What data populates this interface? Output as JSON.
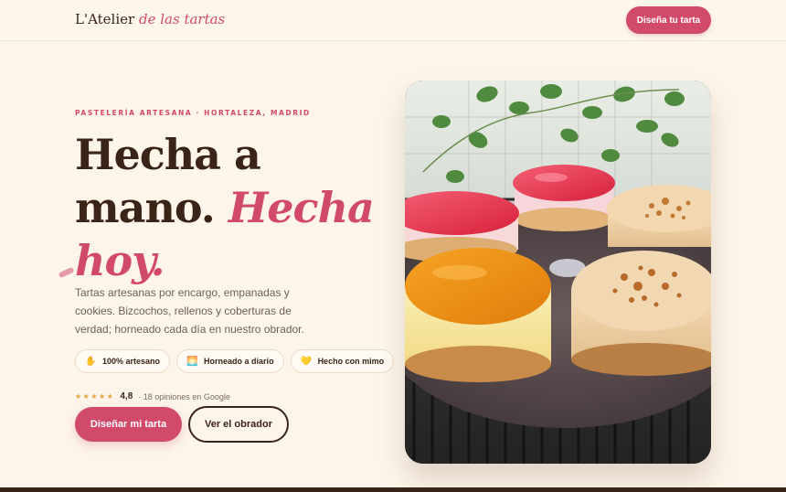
{
  "header": {
    "brand_main": "L'Atelier",
    "brand_accent": "de las tartas",
    "cta_label": "Diseña tu tarta"
  },
  "hero": {
    "eyebrow": "PASTELERÍA ARTESANA · HORTALEZA, MADRID",
    "headline_line1": "Hecha a",
    "headline_line2_plain": "mano.",
    "headline_line2_accent": "Hecha",
    "headline_line3_accent": "hoy.",
    "lead": "Tartas artesanas por encargo, empanadas y cookies. Bizcochos, rellenos y coberturas de verdad; horneado cada día en nuestro obrador.",
    "chips": [
      {
        "icon": "hand-icon",
        "emoji": "✋",
        "label": "100% artesano"
      },
      {
        "icon": "sunrise-icon",
        "emoji": "🌅",
        "label": "Horneado a diario"
      },
      {
        "icon": "heart-icon",
        "emoji": "💛",
        "label": "Hecho con mimo"
      }
    ],
    "rating": {
      "stars": "★★★★★",
      "score": "4,8",
      "reviews_text": "· 18 opiniones en Google"
    },
    "primary_button": "Diseñar mi tarta",
    "secondary_button": "Ver el obrador"
  },
  "colors": {
    "background": "#fdf5e9",
    "accent": "#d24a6a",
    "text": "#3a2418",
    "muted": "#6e5f55"
  }
}
